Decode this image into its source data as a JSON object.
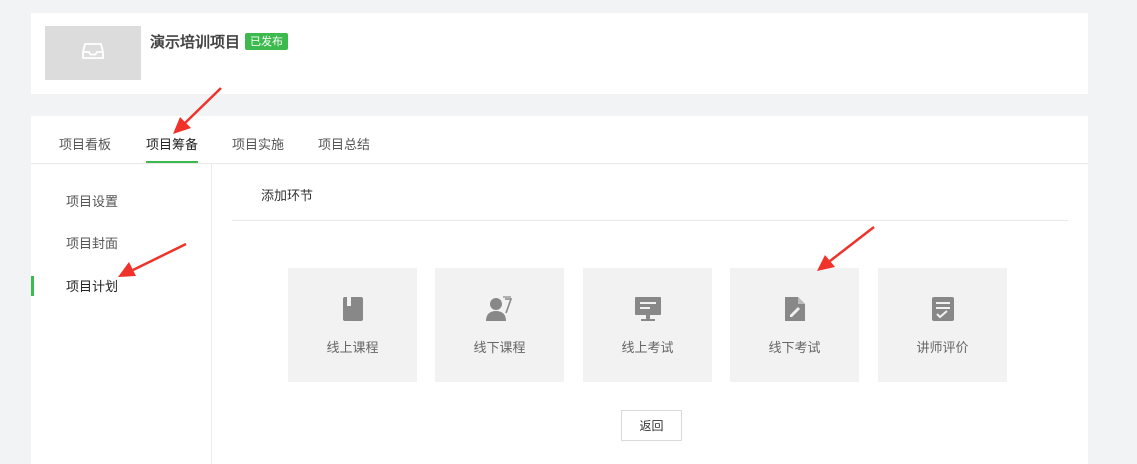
{
  "project": {
    "title": "演示培训项目",
    "status_badge": "已发布"
  },
  "tabs": [
    {
      "label": "项目看板",
      "active": false
    },
    {
      "label": "项目筹备",
      "active": true
    },
    {
      "label": "项目实施",
      "active": false
    },
    {
      "label": "项目总结",
      "active": false
    }
  ],
  "sidebar": {
    "items": [
      {
        "label": "项目设置",
        "active": false
      },
      {
        "label": "项目封面",
        "active": false
      },
      {
        "label": "项目计划",
        "active": true
      }
    ]
  },
  "main": {
    "section_title": "添加环节",
    "steps": [
      {
        "label": "线上课程",
        "icon": "book-icon"
      },
      {
        "label": "线下课程",
        "icon": "teacher-icon"
      },
      {
        "label": "线上考试",
        "icon": "monitor-icon"
      },
      {
        "label": "线下考试",
        "icon": "document-pen-icon"
      },
      {
        "label": "讲师评价",
        "icon": "checklist-icon"
      }
    ],
    "back_label": "返回"
  },
  "colors": {
    "accent": "#3dba4e",
    "annotation_arrow": "#f0322a",
    "card_bg": "#f2f2f2",
    "icon": "#888888"
  }
}
